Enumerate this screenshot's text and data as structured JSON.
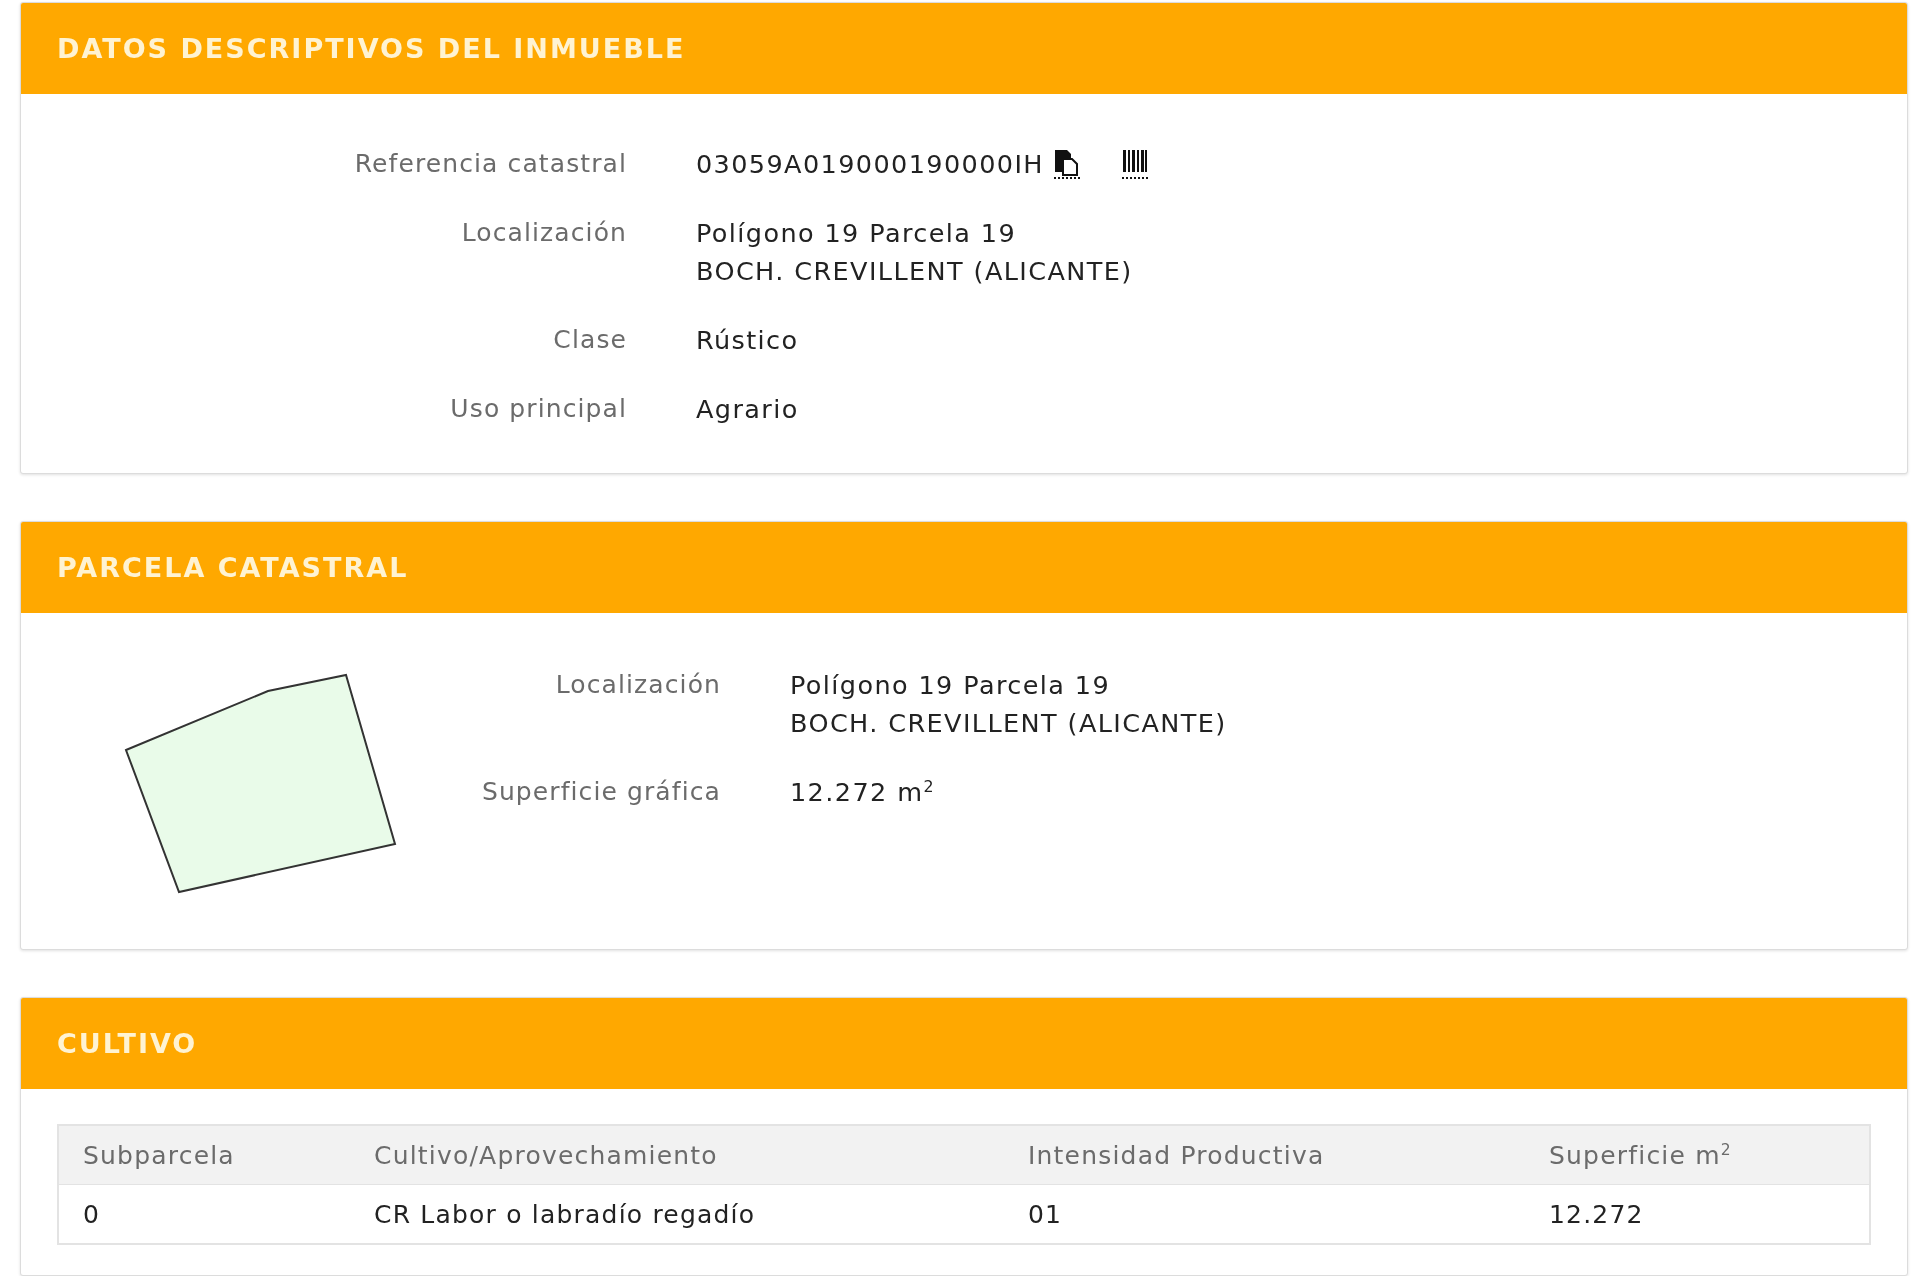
{
  "sections": [
    {
      "kind": "fields",
      "title": "DATOS DESCRIPTIVOS DEL INMUEBLE",
      "fields": [
        {
          "kind": "reference",
          "label": "Referencia catastral",
          "lines": [
            "03059A019000190000IH"
          ]
        },
        {
          "kind": "text",
          "label": "Localización",
          "lines": [
            "Polígono 19 Parcela 19",
            "BOCH. CREVILLENT (ALICANTE)"
          ]
        },
        {
          "kind": "text",
          "label": "Clase",
          "lines": [
            "Rústico"
          ]
        },
        {
          "kind": "text",
          "label": "Uso principal",
          "lines": [
            "Agrario"
          ]
        }
      ]
    },
    {
      "kind": "parcel",
      "title": "PARCELA CATASTRAL",
      "fields": [
        {
          "kind": "text",
          "label": "Localización",
          "lines": [
            "Polígono 19 Parcela 19",
            "BOCH. CREVILLENT (ALICANTE)"
          ]
        },
        {
          "kind": "text",
          "label": "Superficie gráfica",
          "lines": [
            "12.272 m$^{2}$"
          ]
        }
      ]
    },
    {
      "kind": "table",
      "title": "CULTIVO",
      "columns": [
        "Subparcela",
        "Cultivo/Aprovechamiento",
        "Intensidad Productiva",
        "Superficie m$^{2}$"
      ],
      "rows": [
        [
          "0",
          "CR Labor o labradío regadío",
          "01",
          "12.272"
        ]
      ]
    }
  ]
}
